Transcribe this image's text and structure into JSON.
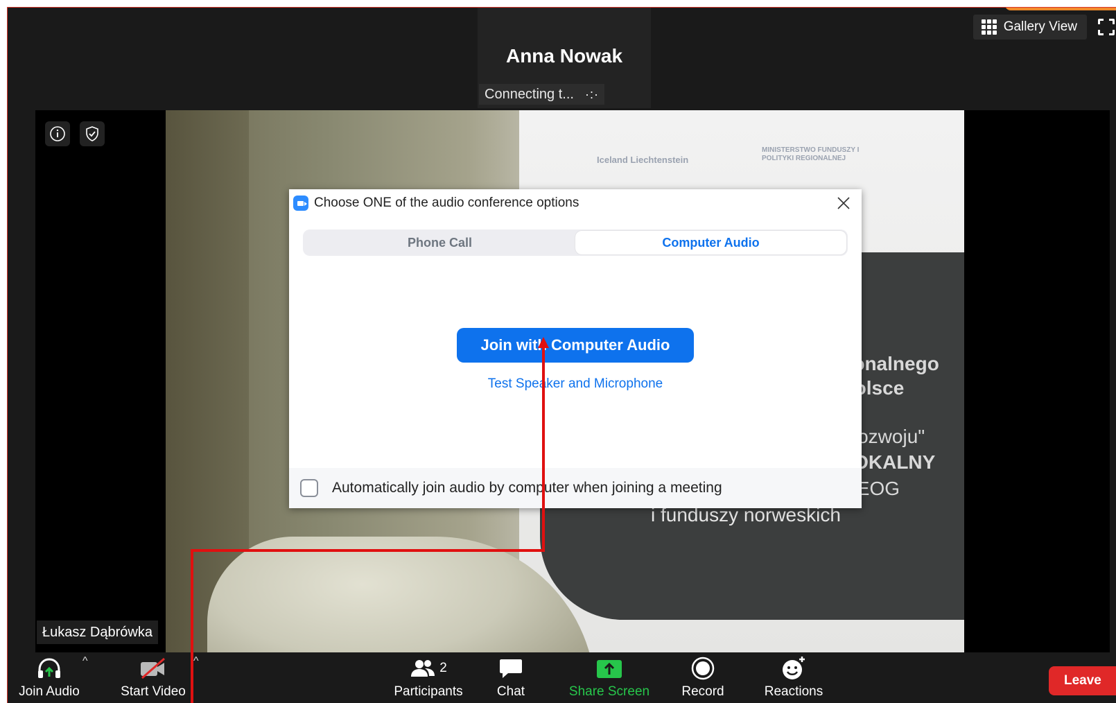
{
  "meeting": {
    "speaker_name": "Anna Nowak",
    "connecting_status": "Connecting t...",
    "connecting_dots": "·:·",
    "gallery_view_label": "Gallery View",
    "participant_name": "Łukasz Dąbrówka"
  },
  "video_banner": {
    "logo_left": "Iceland  Liechtenstein",
    "logo_right": "MINISTERSTWO FUNDUSZY I POLITYKI REGIONALNEJ",
    "line1": "cjonalnego",
    "line2": "Polsce",
    "line3": "k rozwoju\"",
    "line4": "LOKALNY",
    "line5": "y EOG",
    "line6": "i funduszy norweskich"
  },
  "dialog": {
    "title": "Choose ONE of the audio conference options",
    "tabs": [
      {
        "label": "Phone Call",
        "active": false
      },
      {
        "label": "Computer Audio",
        "active": true
      }
    ],
    "join_button_label": "Join with Computer Audio",
    "test_link_label": "Test Speaker and Microphone",
    "auto_join_label": "Automatically join audio by computer when joining a meeting",
    "auto_join_checked": false
  },
  "toolbar": {
    "join_audio": "Join Audio",
    "start_video": "Start Video",
    "participants": "Participants",
    "participants_count": "2",
    "chat": "Chat",
    "share_screen": "Share Screen",
    "record": "Record",
    "reactions": "Reactions",
    "leave": "Leave"
  },
  "colors": {
    "accent_blue": "#0e72ed",
    "share_green": "#27c64b",
    "leave_red": "#e02828",
    "annotation_red": "#e01010"
  }
}
